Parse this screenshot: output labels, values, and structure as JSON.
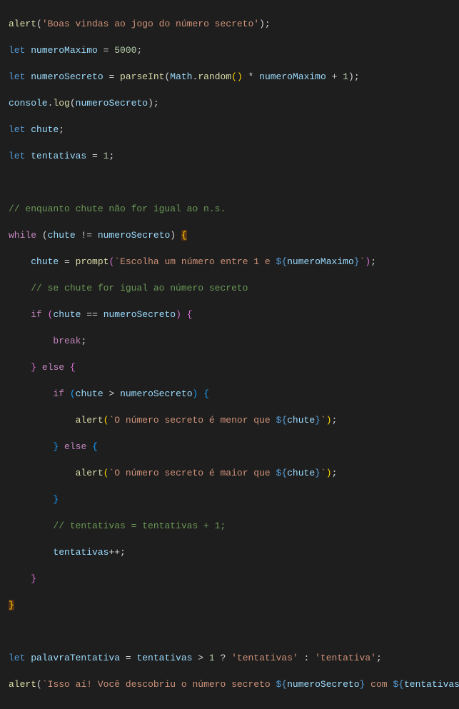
{
  "code": {
    "l1": {
      "fn": "alert",
      "paren_o": "(",
      "str": "'Boas vindas ao jogo do número secreto'",
      "paren_c": ")",
      "semi": ";"
    },
    "l2": {
      "kw": "let",
      "sp": " ",
      "var": "numeroMaximo",
      "eq": " = ",
      "num": "5000",
      "semi": ";"
    },
    "l3": {
      "kw": "let",
      "sp": " ",
      "var": "numeroSecreto",
      "eq": " = ",
      "fn": "parseInt",
      "po": "(",
      "obj": "Math",
      "dot": ".",
      "fn2": "random",
      "po2": "(",
      "pc2": ")",
      "mul": " * ",
      "var2": "numeroMaximo",
      "plus": " + ",
      "num": "1",
      "pc": ")",
      "semi": ";"
    },
    "l4": {
      "obj": "console",
      "dot": ".",
      "fn": "log",
      "po": "(",
      "var": "numeroSecreto",
      "pc": ")",
      "semi": ";"
    },
    "l5": {
      "kw": "let",
      "sp": " ",
      "var": "chute",
      "semi": ";"
    },
    "l6": {
      "kw": "let",
      "sp": " ",
      "var": "tentativas",
      "eq": " = ",
      "num": "1",
      "semi": ";"
    },
    "l8": {
      "cmt": "// enquanto chute não for igual ao n.s."
    },
    "l9": {
      "kw": "while",
      "sp": " ",
      "po": "(",
      "var1": "chute",
      "op": " != ",
      "var2": "numeroSecreto",
      "pc": ")",
      "sp2": " ",
      "bo": "{"
    },
    "l10": {
      "ind": "    ",
      "var": "chute",
      "eq": " = ",
      "fn": "prompt",
      "po": "(",
      "bt": "`",
      "s1": "Escolha um número entre 1 e ",
      "do": "${",
      "tv": "numeroMaximo",
      "dc": "}",
      "bt2": "`",
      "pc": ")",
      "semi": ";"
    },
    "l11": {
      "ind": "    ",
      "cmt": "// se chute for igual ao número secreto"
    },
    "l12": {
      "ind": "    ",
      "kw": "if",
      "sp": " ",
      "po": "(",
      "v1": "chute",
      "op": " == ",
      "v2": "numeroSecreto",
      "pc": ")",
      "sp2": " ",
      "bo": "{"
    },
    "l13": {
      "ind": "        ",
      "kw": "break",
      "semi": ";"
    },
    "l14": {
      "ind": "    ",
      "bc": "}",
      "sp": " ",
      "kw": "else",
      "sp2": " ",
      "bo": "{"
    },
    "l15": {
      "ind": "        ",
      "kw": "if",
      "sp": " ",
      "po": "(",
      "v1": "chute",
      "op": " > ",
      "v2": "numeroSecreto",
      "pc": ")",
      "sp2": " ",
      "bo": "{"
    },
    "l16": {
      "ind": "            ",
      "fn": "alert",
      "po": "(",
      "bt": "`",
      "s1": "O número secreto é menor que ",
      "do": "${",
      "tv": "chute",
      "dc": "}",
      "bt2": "`",
      "pc": ")",
      "semi": ";"
    },
    "l17": {
      "ind": "        ",
      "bc": "}",
      "sp": " ",
      "kw": "else",
      "sp2": " ",
      "bo": "{"
    },
    "l18": {
      "ind": "            ",
      "fn": "alert",
      "po": "(",
      "bt": "`",
      "s1": "O número secreto é maior que ",
      "do": "${",
      "tv": "chute",
      "dc": "}",
      "bt2": "`",
      "pc": ")",
      "semi": ";"
    },
    "l19": {
      "ind": "        ",
      "bc": "}"
    },
    "l20": {
      "ind": "        ",
      "cmt": "// tentativas = tentativas + 1;"
    },
    "l21": {
      "ind": "        ",
      "var": "tentativas",
      "op": "++",
      "semi": ";"
    },
    "l22": {
      "ind": "    ",
      "bc": "}"
    },
    "l23": {
      "bc": "}"
    },
    "l25": {
      "kw": "let",
      "sp": " ",
      "var": "palavraTentativa",
      "eq": " = ",
      "v2": "tentativas",
      "op": " > ",
      "num": "1",
      "q": " ? ",
      "s1": "'tentativas'",
      "col": " : ",
      "s2": "'tentativa'",
      "semi": ";"
    },
    "l26": {
      "fn": "alert",
      "po": "(",
      "bt": "`",
      "s1": "Isso aí! Você descobriu o número secreto ",
      "do1": "${",
      "tv1": "numeroSecreto",
      "dc1": "}",
      "s2": " com ",
      "do2": "${",
      "tv2": "tentativas",
      "dc2": "}"
    }
  }
}
